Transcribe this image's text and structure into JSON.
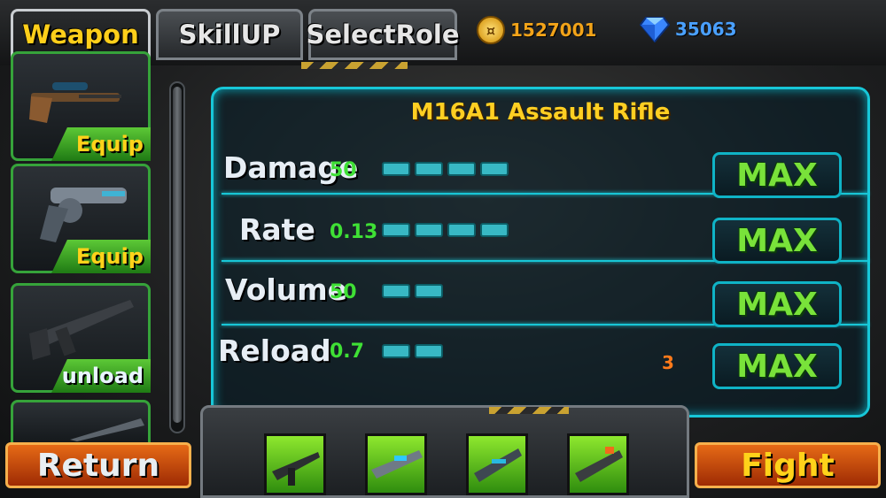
{
  "tabs": [
    {
      "label": "Weapon",
      "active": true
    },
    {
      "label": "SkillUP",
      "active": false
    },
    {
      "label": "SelectRole",
      "active": false
    }
  ],
  "currency": {
    "coins": {
      "icon": "coin-icon",
      "value": "1527001",
      "color": "#f2a319"
    },
    "gems": {
      "icon": "diamond-icon",
      "value": "35063",
      "color": "#4aa0ff"
    }
  },
  "weapon_list": [
    {
      "icon": "sniper-rifle-icon",
      "action": "Equip"
    },
    {
      "icon": "revolver-icon",
      "action": "Equip"
    },
    {
      "icon": "assault-rifle-icon",
      "action": "unload"
    },
    {
      "icon": "shotgun-icon",
      "action": ""
    }
  ],
  "stats_panel": {
    "title": "M16A1 Assault Rifle",
    "rows": [
      {
        "label": "Damage",
        "value": "50",
        "level": 4,
        "button": "MAX"
      },
      {
        "label": "Rate",
        "value": "0.13",
        "level": 4,
        "button": "MAX"
      },
      {
        "label": "Volume",
        "value": "50",
        "level": 2,
        "button": "MAX"
      },
      {
        "label": "Reload",
        "value": "0.7",
        "level": 2,
        "button": "MAX",
        "extra": "3"
      }
    ]
  },
  "loadout_slots": [
    {
      "icon": "assault-rifle-icon"
    },
    {
      "icon": "laser-rifle-icon"
    },
    {
      "icon": "plasma-gun-icon"
    },
    {
      "icon": "heavy-gun-icon"
    }
  ],
  "buttons": {
    "return": "Return",
    "fight": "Fight"
  },
  "colors": {
    "accent": "#17c7d8",
    "active_tab": "#ffcf1a",
    "equip_green": "#3fb22a",
    "action_orange": "#e05a14"
  }
}
